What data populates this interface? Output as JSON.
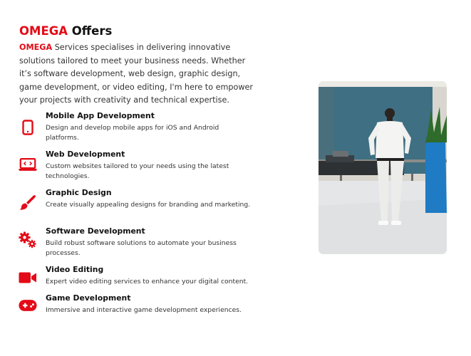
{
  "accent_color": "#e30b17",
  "header": {
    "brand": "OMEGA",
    "title_rest": "Offers"
  },
  "intro": {
    "brand": "OMEGA",
    "text": "Services specialises in delivering innovative solutions tailored to meet your business needs. Whether it’s software development, web design, graphic design, game development, or video editing, I'm here to empower your projects with creativity and technical expertise."
  },
  "services": [
    {
      "icon": "mobile-phone-icon",
      "name": "Mobile App Development",
      "desc": "Design and develop mobile apps for iOS and Android platforms."
    },
    {
      "icon": "laptop-code-icon",
      "name": "Web Development",
      "desc": "Custom websites tailored to your needs using the latest technologies."
    },
    {
      "icon": "paint-brush-icon",
      "name": "Graphic Design",
      "desc": "Create visually appealing designs for branding and marketing."
    },
    {
      "icon": "gears-icon",
      "name": "Software Development",
      "desc": "Build robust software solutions to automate your business processes."
    },
    {
      "icon": "video-camera-icon",
      "name": "Video Editing",
      "desc": "Expert video editing services to enhance your digital content."
    },
    {
      "icon": "gamepad-icon",
      "name": "Game Development",
      "desc": "Immersive and interactive game development experiences."
    }
  ]
}
